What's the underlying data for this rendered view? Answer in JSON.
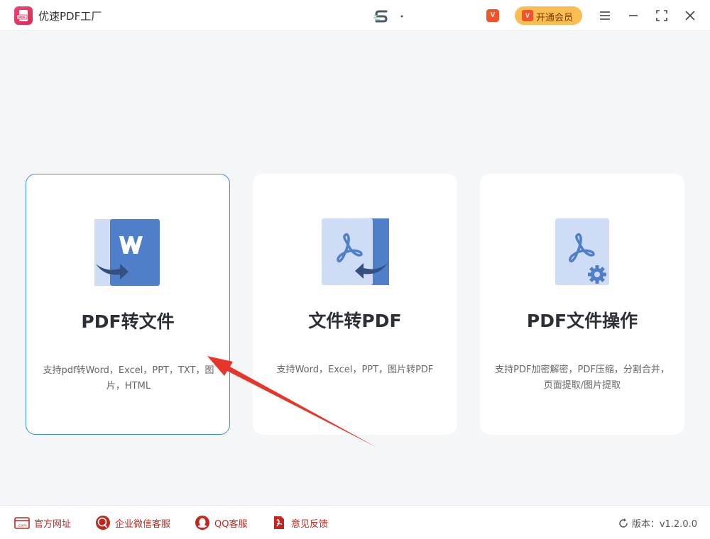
{
  "app": {
    "title": "优速PDF工厂"
  },
  "header": {
    "vip_label": "开通会员"
  },
  "cards": [
    {
      "title": "PDF转文件",
      "desc": "支持pdf转Word，Excel，PPT，TXT，图片，HTML",
      "icon": "pdf-to-word-icon"
    },
    {
      "title": "文件转PDF",
      "desc": "支持Word，Excel，PPT，图片转PDF",
      "icon": "file-to-pdf-icon"
    },
    {
      "title": "PDF文件操作",
      "desc": "支持PDF加密解密，PDF压缩，分割合并，页面提取/图片提取",
      "icon": "pdf-settings-icon"
    }
  ],
  "footer": {
    "links": [
      {
        "label": "官方网址",
        "icon": "website-icon"
      },
      {
        "label": "企业微信客服",
        "icon": "wecom-icon"
      },
      {
        "label": "QQ客服",
        "icon": "qq-icon"
      },
      {
        "label": "意见反馈",
        "icon": "feedback-icon"
      }
    ],
    "version": "版本：v1.2.0.0"
  },
  "colors": {
    "accent": "#3a8ee6",
    "brand": "#e8365d",
    "vip": "#fbbd52",
    "footer_text": "#c0281f",
    "icon_blue": "#4f7fc9",
    "icon_light": "#cfdcf5"
  }
}
